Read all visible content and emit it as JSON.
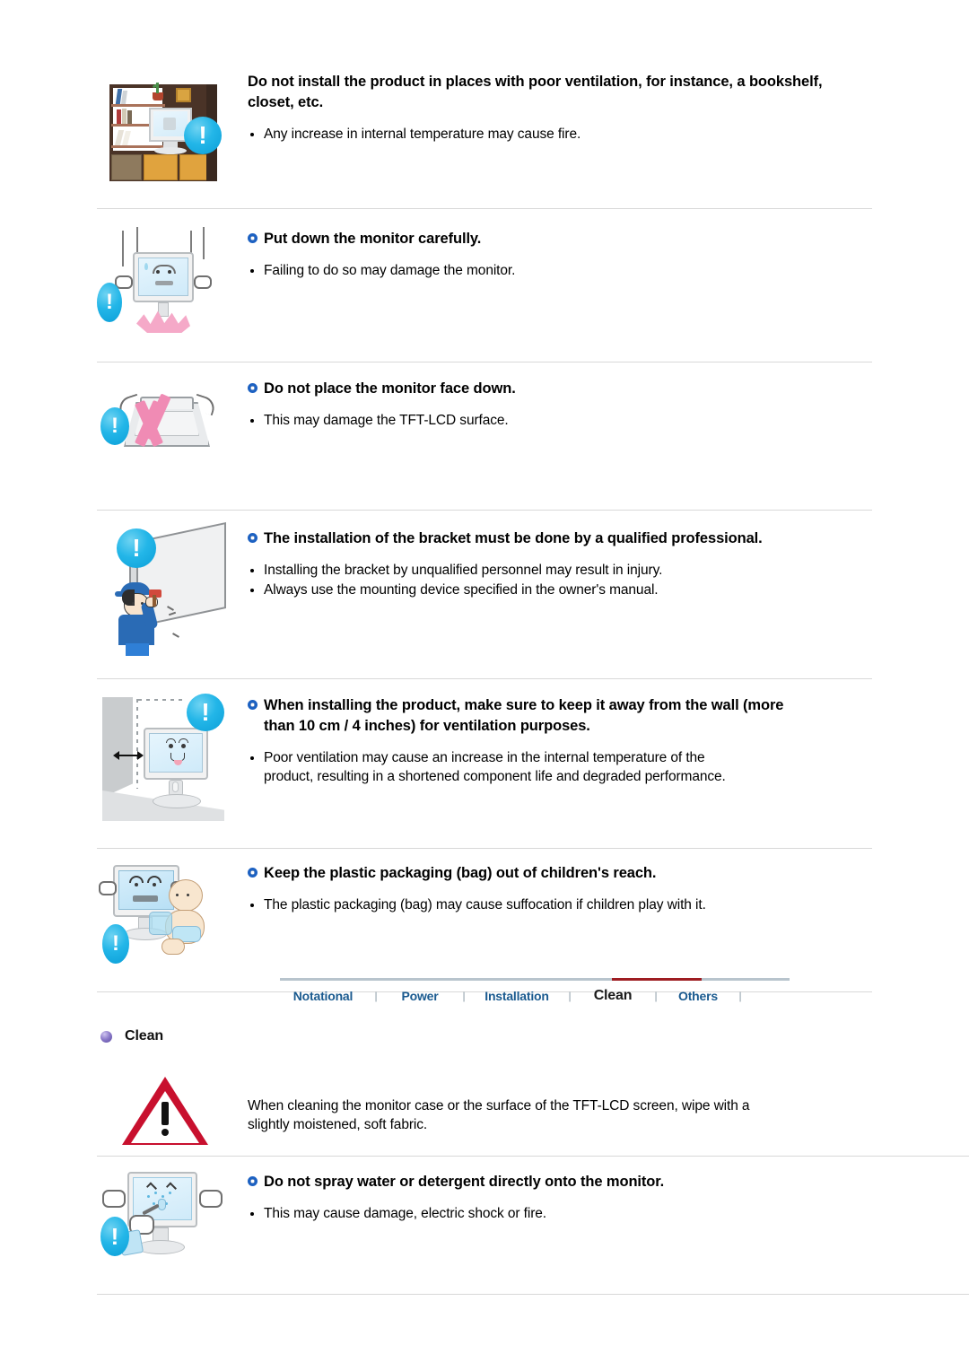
{
  "document": {
    "type": "monitor-safety-instructions-page"
  },
  "sections": [
    {
      "id": "ventilation-bookshelf",
      "illustration": "bookshelf-with-monitor",
      "has_heading_bullet": false,
      "heading": "Do not install the product in places with poor ventilation, for instance, a bookshelf, closet, etc.",
      "bullets": [
        "Any increase in internal temperature may cause fire."
      ]
    },
    {
      "id": "put-down-carefully",
      "illustration": "monitor-dropping",
      "has_heading_bullet": true,
      "heading": "Put down the monitor carefully.",
      "bullets": [
        "Failing to do so may damage the monitor."
      ]
    },
    {
      "id": "face-down",
      "illustration": "monitor-face-down-x",
      "has_heading_bullet": true,
      "heading": "Do not place the monitor face down.",
      "bullets": [
        "This may damage the TFT-LCD surface."
      ]
    },
    {
      "id": "bracket-install",
      "illustration": "technician-wall-bracket",
      "has_heading_bullet": true,
      "heading": "The installation of the bracket must be done by a qualified professional.",
      "bullets": [
        "Installing the bracket by unqualified personnel may result in injury.",
        "Always use the mounting device specified in the owner's manual."
      ]
    },
    {
      "id": "wall-clearance",
      "illustration": "monitor-away-from-wall",
      "has_heading_bullet": true,
      "heading": "When installing the product, make sure to keep it away from the wall (more than 10 cm / 4 inches) for ventilation purposes.",
      "bullets": [
        "Poor ventilation may cause an increase in the internal temperature of the product, resulting in a shortened component life and degraded performance."
      ]
    },
    {
      "id": "plastic-bag",
      "illustration": "baby-with-plastic-bag",
      "has_heading_bullet": true,
      "heading": "Keep the plastic packaging (bag) out of children's reach.",
      "bullets": [
        "The plastic packaging (bag) may cause suffocation if children play with it."
      ]
    }
  ],
  "tabnav": {
    "tabs": [
      {
        "label": "Notational",
        "active": false
      },
      {
        "label": "Power",
        "active": false
      },
      {
        "label": "Installation",
        "active": false
      },
      {
        "label": "Clean",
        "active": true
      },
      {
        "label": "Others",
        "active": false
      }
    ],
    "separator": "|",
    "active_bar_color": "#9e1d22",
    "line_color": "#b8c4cd",
    "link_color": "#1a5a8f"
  },
  "clean_section": {
    "title": "Clean",
    "bullet_icon": "purple-sphere-icon",
    "note": {
      "illustration": "red-triangle-warning",
      "text": "When cleaning the monitor case or the surface of the TFT-LCD screen, wipe with a slightly moistened, soft fabric."
    },
    "items": [
      {
        "id": "no-spray",
        "illustration": "spraying-monitor",
        "heading": "Do not spray water or detergent directly onto the monitor.",
        "bullets": [
          "This may cause damage, electric shock or fire."
        ]
      }
    ]
  },
  "icons": {
    "exclamation": "!",
    "warning_triangle_mark": "!"
  },
  "colors": {
    "badge_blue": "#23b6e8",
    "heading_bullet_blue": "#1c61c2",
    "warning_red": "#c8102e",
    "pink_x": "#f08bb4",
    "tab_active_underline": "#9e1d22"
  }
}
